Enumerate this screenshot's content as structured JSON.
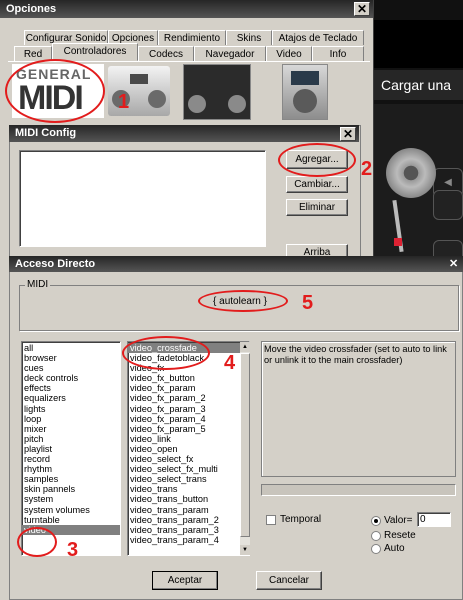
{
  "opciones": {
    "title": "Opciones",
    "tabs_row1": [
      "Configurar Sonido",
      "Opciones",
      "Rendimiento",
      "Skins",
      "Atajos de Teclado"
    ],
    "tabs_row2": [
      "Red",
      "Controladores",
      "Codecs",
      "Navegador",
      "Video",
      "Info"
    ],
    "general_midi_top": "GENERAL",
    "general_midi_bottom": "MIDI"
  },
  "background": {
    "cargar_label": "Cargar una"
  },
  "midi_config": {
    "title": "MIDI Config",
    "buttons": {
      "agregar": "Agregar...",
      "cambiar": "Cambiar...",
      "eliminar": "Eliminar",
      "arriba": "Arriba"
    }
  },
  "acceso": {
    "title": "Acceso Directo",
    "midi_label": "MIDI",
    "autolearn": "{ autolearn }",
    "categories": [
      "all",
      "browser",
      "cues",
      "deck controls",
      "effects",
      "equalizers",
      "lights",
      "loop",
      "mixer",
      "pitch",
      "playlist",
      "record",
      "rhythm",
      "samples",
      "skin pannels",
      "system",
      "system volumes",
      "turntable",
      "video"
    ],
    "actions": [
      "video_crossfade",
      "video_fadetoblack",
      "video_fx",
      "video_fx_button",
      "video_fx_param",
      "video_fx_param_2",
      "video_fx_param_3",
      "video_fx_param_4",
      "video_fx_param_5",
      "video_link",
      "video_open",
      "video_select_fx",
      "video_select_fx_multi",
      "video_select_trans",
      "video_trans",
      "video_trans_button",
      "video_trans_param",
      "video_trans_param_2",
      "video_trans_param_3",
      "video_trans_param_4"
    ],
    "description": "Move the video crossfader (set to auto to link or unlink it to the main crossfader)",
    "temporal": "Temporal",
    "valor_label": "Valor=",
    "valor_value": "0",
    "resete": "Resete",
    "auto": "Auto",
    "aceptar": "Aceptar",
    "cancelar": "Cancelar"
  },
  "annotations": {
    "n1": "1",
    "n2": "2",
    "n3": "3",
    "n4": "4",
    "n5": "5"
  },
  "colors": {
    "annotation": "#e21c1c",
    "titlebar": "#3a3a3a"
  }
}
